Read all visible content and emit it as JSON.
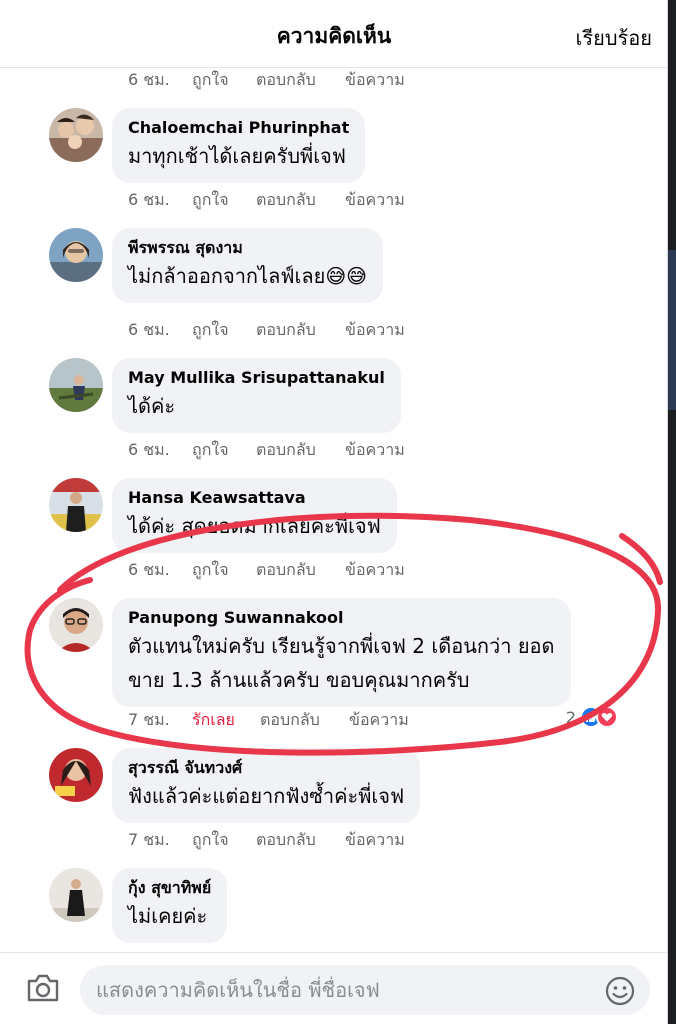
{
  "header": {
    "title": "ความคิดเห็น",
    "done_label": "เรียบร้อย"
  },
  "action_labels": {
    "like": "ถูกใจ",
    "loved": "รักเลย",
    "reply": "ตอบกลับ",
    "message": "ข้อความ"
  },
  "top_actions": {
    "time": "6 ชม."
  },
  "comments": [
    {
      "name": "Chaloemchai Phurinphat",
      "text": "มาทุกเช้าได้เลยครับพี่เจฟ",
      "time": "6 ชม."
    },
    {
      "name": "พีรพรรณ สุดงาม",
      "text": "ไม่กล้าออกจากไลฟ์เลย😅😅",
      "time": "6 ชม."
    },
    {
      "name": "May Mullika Srisupattanakul",
      "text": "ได้ค่ะ",
      "time": "6 ชม."
    },
    {
      "name": "Hansa Keawsattava",
      "text": "ได้ค่ะ สุดยอดมากเลยค่ะพี่เจฟ",
      "time": "6 ชม."
    },
    {
      "name": "Panupong Suwannakool",
      "text_line1": "ตัวแทนใหม่ครับ เรียนรู้จากพี่เจฟ 2 เดือนกว่า ยอด",
      "text_line2": "ขาย 1.3 ล้านแล้วครับ ขอบคุณมากครับ",
      "time": "7 ชม.",
      "reaction_count": "2"
    },
    {
      "name": "สุวรรณี จันทวงศ์",
      "text": "ฟังแล้วค่ะแต่อยากฟังซ้ำค่ะพี่เจฟ",
      "time": "7 ชม."
    },
    {
      "name": "กุ้ง สุขาทิพย์",
      "text": "ไม่เคยค่ะ"
    }
  ],
  "composer": {
    "placeholder": "แสดงความคิดเห็นในชื่อ พี่ชื่อเจฟ",
    "camera_icon": "camera-icon",
    "emoji_icon": "emoji-icon"
  },
  "colors": {
    "bubble": "#f0f2f5",
    "meta": "#65676b",
    "loved": "#e41e3f",
    "annotation": "#e8374a",
    "like_blue": "#1877f2"
  }
}
